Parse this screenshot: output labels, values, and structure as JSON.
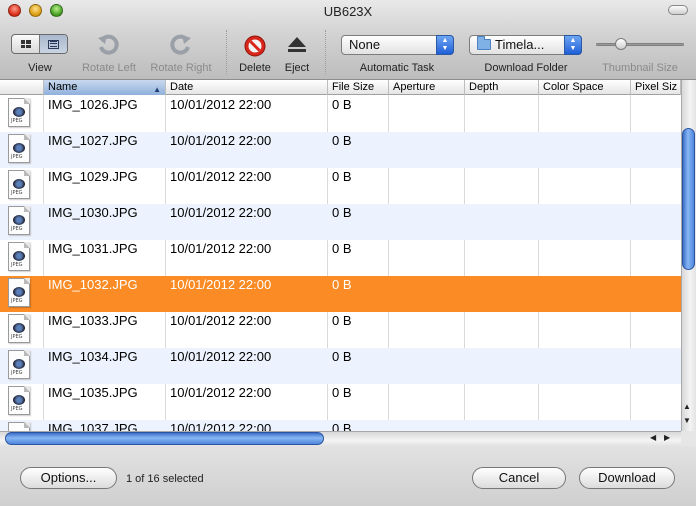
{
  "window": {
    "title": "UB623X"
  },
  "toolbar": {
    "view_label": "View",
    "rotate_left_label": "Rotate Left",
    "rotate_right_label": "Rotate Right",
    "delete_label": "Delete",
    "eject_label": "Eject",
    "automatic_task_label": "Automatic Task",
    "automatic_task_value": "None",
    "download_folder_label": "Download Folder",
    "download_folder_value": "Timela...",
    "thumbnail_size_label": "Thumbnail Size",
    "thumbnail_size_value": 0.25
  },
  "table": {
    "columns": [
      "Name",
      "Date",
      "File Size",
      "Aperture",
      "Depth",
      "Color Space",
      "Pixel Siz"
    ],
    "sorted_column": "Name",
    "rows": [
      {
        "name": "IMG_1026.JPG",
        "date": "10/01/2012 22:00",
        "size": "0 B"
      },
      {
        "name": "IMG_1027.JPG",
        "date": "10/01/2012 22:00",
        "size": "0 B"
      },
      {
        "name": "IMG_1029.JPG",
        "date": "10/01/2012 22:00",
        "size": "0 B"
      },
      {
        "name": "IMG_1030.JPG",
        "date": "10/01/2012 22:00",
        "size": "0 B"
      },
      {
        "name": "IMG_1031.JPG",
        "date": "10/01/2012 22:00",
        "size": "0 B"
      },
      {
        "name": "IMG_1032.JPG",
        "date": "10/01/2012 22:00",
        "size": "0 B",
        "selected": true
      },
      {
        "name": "IMG_1033.JPG",
        "date": "10/01/2012 22:00",
        "size": "0 B"
      },
      {
        "name": "IMG_1034.JPG",
        "date": "10/01/2012 22:00",
        "size": "0 B"
      },
      {
        "name": "IMG_1035.JPG",
        "date": "10/01/2012 22:00",
        "size": "0 B"
      },
      {
        "name": "IMG_1037.JPG",
        "date": "10/01/2012 22:00",
        "size": "0 B"
      }
    ],
    "thumbnail_icon": "jpeg-file-icon",
    "thumbnail_text": "JPEG"
  },
  "footer": {
    "options_label": "Options...",
    "status": "1 of 16 selected",
    "cancel_label": "Cancel",
    "download_label": "Download"
  },
  "colors": {
    "selection": "#fb8b24",
    "alt_row": "#edf3fe",
    "accent": "#3c6fc8"
  }
}
